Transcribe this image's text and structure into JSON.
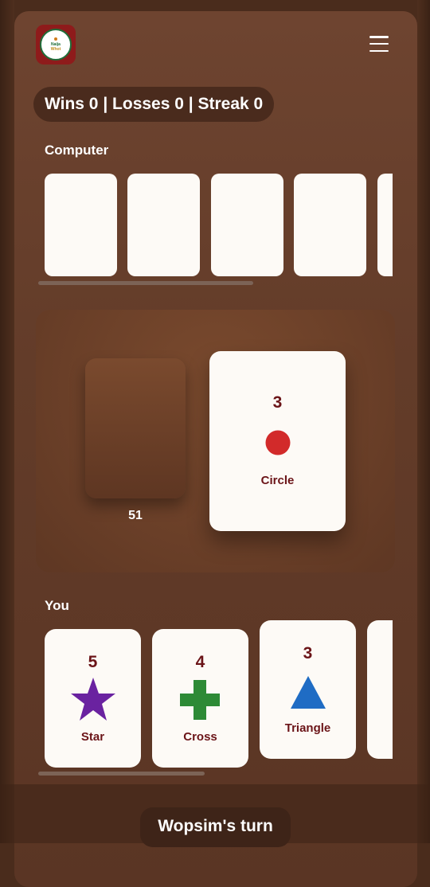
{
  "header": {
    "logo_line1": "Naija",
    "logo_line2": "Whot",
    "menu_icon": "hamburger-menu-icon"
  },
  "score": {
    "text": "Wins 0 | Losses 0 | Streak 0"
  },
  "computer": {
    "label": "Computer",
    "visible_cards": 5
  },
  "table": {
    "deck_count": "51",
    "top_card": {
      "number": "3",
      "shape": "Circle",
      "color": "#d22a2a"
    }
  },
  "you": {
    "label": "You",
    "cards": [
      {
        "number": "5",
        "shape": "Star",
        "color": "#6a22a0"
      },
      {
        "number": "4",
        "shape": "Cross",
        "color": "#2d8a36"
      },
      {
        "number": "3",
        "shape": "Triangle",
        "color": "#1f6cc4"
      }
    ]
  },
  "status": {
    "turn_text": "Wopsim's turn"
  },
  "colors": {
    "card_text": "#6b1418",
    "card_bg": "#fdfaf6",
    "panel_bg": "#6e4430",
    "logo_bg": "#8e1b1b"
  }
}
